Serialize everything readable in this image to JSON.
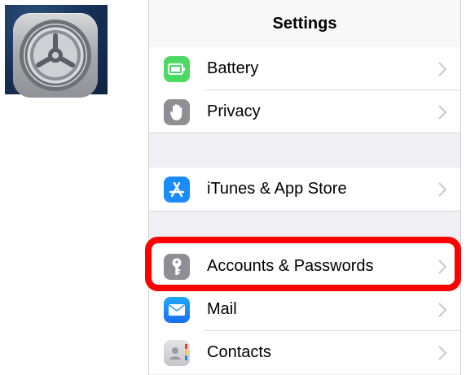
{
  "nav": {
    "title": "Settings"
  },
  "rows": [
    {
      "label": "Battery",
      "icon": "battery-icon",
      "icon_color": "#4cd964"
    },
    {
      "label": "Privacy",
      "icon": "privacy-hand-icon",
      "icon_color": "#8e8e93"
    },
    {
      "label": "iTunes & App Store",
      "icon": "app-store-icon",
      "icon_color": "#1a8cff"
    },
    {
      "label": "Accounts & Passwords",
      "icon": "key-icon",
      "icon_color": "#8e8e93"
    },
    {
      "label": "Mail",
      "icon": "mail-icon",
      "icon_color": "#1e8eff"
    },
    {
      "label": "Contacts",
      "icon": "contacts-icon",
      "icon_color": "#b9b9bd"
    }
  ],
  "highlight_color": "#ff0000",
  "app_icon": "settings-gear-icon"
}
